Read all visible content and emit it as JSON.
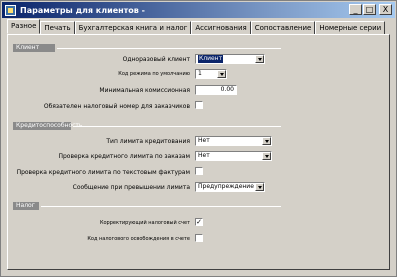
{
  "window": {
    "title": "Параметры для клиентов -"
  },
  "title_buttons": {
    "minimize": "_",
    "maximize": "□",
    "close": "X"
  },
  "tabs": [
    {
      "label": "Разное",
      "active": true
    },
    {
      "label": "Печать"
    },
    {
      "label": "Бухгалтерская книга и налог"
    },
    {
      "label": "Ассигнования"
    },
    {
      "label": "Сопоставление"
    },
    {
      "label": "Номерные серии"
    }
  ],
  "groups": {
    "client": {
      "header": "Клиент",
      "one_time_customer": {
        "label": "Одноразовый клиент",
        "value": "Клиент"
      },
      "default_mode": {
        "label": "Код режима по умолчанию",
        "value": "1"
      },
      "min_commission": {
        "label": "Минимальная комиссионная",
        "value": "0.00"
      },
      "tax_number_required": {
        "label": "Обязателен налоговый номер для заказчиков",
        "checked": false
      }
    },
    "credit": {
      "header": "Кредитоспособность",
      "limit_type": {
        "label": "Тип лимита кредитования",
        "value": "Нет"
      },
      "check_orders": {
        "label": "Проверка кредитного лимита по заказам",
        "value": "Нет"
      },
      "check_text_invoices": {
        "label": "Проверка кредитного лимита по текстовым фактурам",
        "checked": false
      },
      "exceed_message": {
        "label": "Сообщение при превышении лимита",
        "value": "Предупреждение"
      }
    },
    "tax": {
      "header": "Налог",
      "correction_invoice": {
        "label": "Корректирующий налоговый счет",
        "checked": true
      },
      "exemption_code": {
        "label": "Код налогового освобождения в счете",
        "checked": false
      }
    }
  }
}
